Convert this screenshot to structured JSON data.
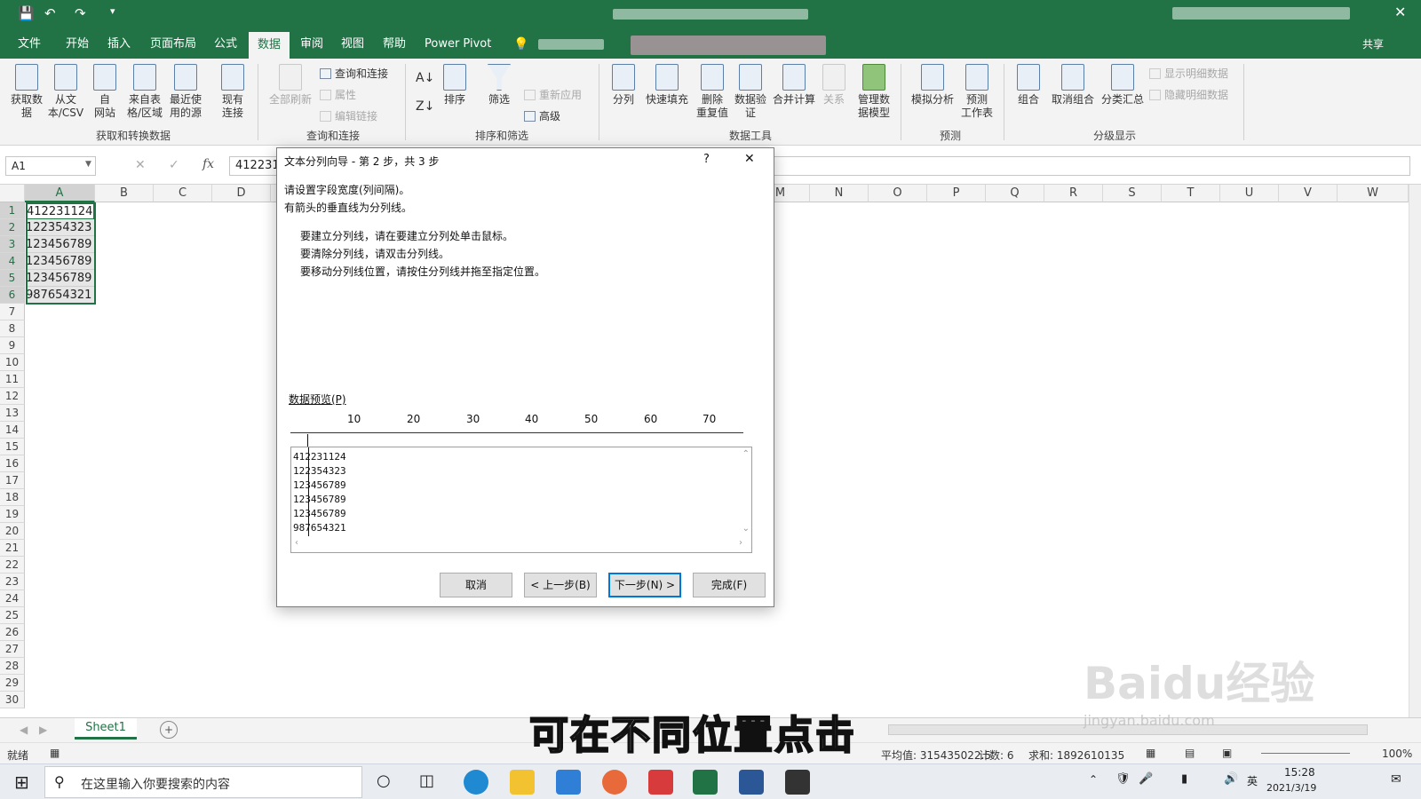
{
  "ribbon_tabs": [
    "文件",
    "开始",
    "插入",
    "页面布局",
    "公式",
    "数据",
    "审阅",
    "视图",
    "帮助",
    "Power Pivot"
  ],
  "active_tab": "数据",
  "share_label": "共享",
  "ribbon": {
    "get_data": "获取数\n据",
    "from_text_csv": "从文\n本/CSV",
    "from_web": "自\n网站",
    "from_table": "来自表\n格/区域",
    "recent_sources": "最近使\n用的源",
    "existing_conn": "现有\n连接",
    "refresh_all": "全部刷新",
    "queries_conn": "查询和连接",
    "properties": "属性",
    "edit_links": "编辑链接",
    "sort": "排序",
    "filter": "筛选",
    "reapply": "重新应用",
    "advanced": "高级",
    "text_to_columns": "分列",
    "flash_fill": "快速填充",
    "remove_dup": "删除\n重复值",
    "data_validation": "数据验\n证",
    "consolidate": "合并计算",
    "relationships": "关系",
    "manage_model": "管理数\n据模型",
    "what_if": "模拟分析",
    "forecast_sheet": "预测\n工作表",
    "group": "组合",
    "ungroup": "取消组合",
    "subtotal": "分类汇总",
    "show_detail": "显示明细数据",
    "hide_detail": "隐藏明细数据",
    "groups": [
      "获取和转换数据",
      "查询和连接",
      "排序和筛选",
      "数据工具",
      "预测",
      "分级显示"
    ]
  },
  "formula_bar": {
    "name_box": "A1",
    "fx": "fx",
    "value": "412231"
  },
  "columns": [
    "A",
    "B",
    "C",
    "D",
    "M",
    "N",
    "O",
    "P",
    "Q",
    "R",
    "S",
    "T",
    "U",
    "V",
    "W"
  ],
  "rows": [
    "1",
    "2",
    "3",
    "4",
    "5",
    "6",
    "7",
    "8",
    "9",
    "10",
    "11",
    "12",
    "13",
    "14",
    "15",
    "16",
    "17",
    "18",
    "19",
    "20",
    "21",
    "22",
    "23",
    "24",
    "25",
    "26",
    "27",
    "28",
    "29",
    "30"
  ],
  "cells": [
    "412231124",
    "122354323",
    "123456789",
    "123456789",
    "123456789",
    "987654321"
  ],
  "dialog": {
    "title": "文本分列向导 - 第 2 步，共 3 步",
    "help": "?",
    "close": "✕",
    "line1": "请设置字段宽度(列间隔)。",
    "line2": "有箭头的垂直线为分列线。",
    "instr1": "要建立分列线，请在要建立分列处单击鼠标。",
    "instr2": "要清除分列线，请双击分列线。",
    "instr3": "要移动分列线位置，请按住分列线并拖至指定位置。",
    "preview_label": "数据预览(P)",
    "ruler": [
      "10",
      "20",
      "30",
      "40",
      "50",
      "60",
      "70"
    ],
    "preview_lines": [
      "412231124",
      "122354323",
      "123456789",
      "123456789",
      "123456789",
      "987654321"
    ],
    "cancel": "取消",
    "back": "< 上一步(B)",
    "next": "下一步(N) >",
    "finish": "完成(F)"
  },
  "sheet_tab": "Sheet1",
  "add_sheet": "+",
  "status": {
    "ready": "就绪",
    "average": "平均值: 315435022.5",
    "count": "计数: 6",
    "sum": "求和: 1892610135",
    "zoom": "100%"
  },
  "taskbar": {
    "search_placeholder": "在这里输入你要搜索的内容",
    "time": "15:28",
    "date": "2021/3/19",
    "ime": "英"
  },
  "subtitle": "可在不同位置点击",
  "watermark": "Baidu经验",
  "watermark_url": "jingyan.baidu.com"
}
